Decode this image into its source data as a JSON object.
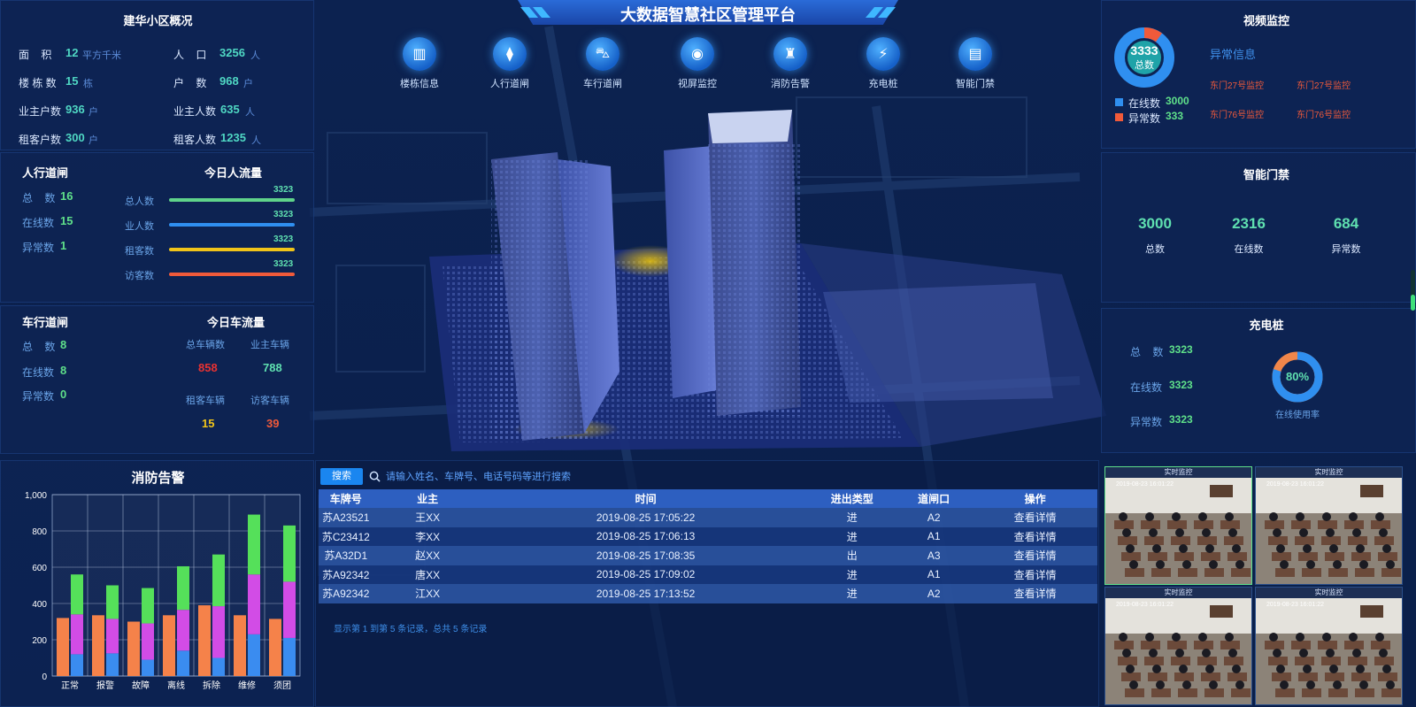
{
  "header": {
    "title": "大数据智慧社区管理平台"
  },
  "nav": [
    {
      "label": "楼栋信息",
      "icon": "building-icon"
    },
    {
      "label": "人行道闸",
      "icon": "pedestrian-gate-icon"
    },
    {
      "label": "车行道闸",
      "icon": "vehicle-gate-icon"
    },
    {
      "label": "视屏监控",
      "icon": "camera-icon"
    },
    {
      "label": "消防告警",
      "icon": "fire-hydrant-icon"
    },
    {
      "label": "充电桩",
      "icon": "charging-pile-icon"
    },
    {
      "label": "智能门禁",
      "icon": "door-access-icon"
    }
  ],
  "overview": {
    "title": "建华小区概况",
    "area_label": "面    积",
    "area_value": "12",
    "area_unit": "平方千米",
    "pop_label": "人    口",
    "pop_value": "3256",
    "pop_unit": "人",
    "bld_label": "楼 栋 数",
    "bld_value": "15",
    "bld_unit": "栋",
    "hh_label": "户    数",
    "hh_value": "968",
    "hh_unit": "户",
    "owner_hh_label": "业主户数",
    "owner_hh_value": "936",
    "owner_hh_unit": "户",
    "owner_pop_label": "业主人数",
    "owner_pop_value": "635",
    "owner_pop_unit": "人",
    "tenant_hh_label": "租客户数",
    "tenant_hh_value": "300",
    "tenant_hh_unit": "户",
    "tenant_pop_label": "租客人数",
    "tenant_pop_value": "1235",
    "tenant_pop_unit": "人"
  },
  "ped_gate": {
    "title": "人行道闸",
    "total_label": "总    数",
    "total_value": "16",
    "online_label": "在线数",
    "online_value": "15",
    "abn_label": "异常数",
    "abn_value": "1"
  },
  "ped_flow": {
    "title": "今日人流量",
    "rows": [
      {
        "label": "总人数",
        "value": "3323",
        "color": "#5fd38a"
      },
      {
        "label": "业人数",
        "value": "3323",
        "color": "#2f8ff0"
      },
      {
        "label": "租客数",
        "value": "3323",
        "color": "#f0c419"
      },
      {
        "label": "访客数",
        "value": "3323",
        "color": "#f05a3a"
      }
    ]
  },
  "car_gate": {
    "title": "车行道闸",
    "total_label": "总    数",
    "total_value": "8",
    "online_label": "在线数",
    "online_value": "8",
    "abn_label": "异常数",
    "abn_value": "0"
  },
  "car_flow": {
    "title": "今日车流量",
    "total_label": "总车辆数",
    "total_value": "858",
    "owner_label": "业主车辆",
    "owner_value": "788",
    "tenant_label": "租客车辆",
    "tenant_value": "15",
    "visitor_label": "访客车辆",
    "visitor_value": "39"
  },
  "fire": {
    "title": "消防告警",
    "chart_data": {
      "type": "bar",
      "categories": [
        "正常",
        "报警",
        "故障",
        "离线",
        "拆除",
        "维修",
        "须团"
      ],
      "ylim": [
        0,
        1000
      ],
      "yticks": [
        "0",
        "200",
        "400",
        "600",
        "800",
        "1,000"
      ],
      "series": [
        {
          "color": "#f5824a",
          "values": [
            320,
            335,
            300,
            335,
            390,
            335,
            315
          ]
        },
        {
          "color": "#3a8cf0",
          "values": [
            120,
            125,
            90,
            140,
            100,
            230,
            210
          ]
        },
        {
          "color": "#d24ce6",
          "values": [
            220,
            190,
            200,
            225,
            285,
            330,
            310
          ]
        },
        {
          "color": "#55e05a",
          "values": [
            220,
            185,
            195,
            240,
            285,
            330,
            310
          ]
        }
      ]
    }
  },
  "search": {
    "button": "搜索",
    "placeholder": "请输入姓名、车牌号、电话号码等进行搜索"
  },
  "table": {
    "headers": [
      "车牌号",
      "业主",
      "时间",
      "进出类型",
      "道闸口",
      "操作"
    ],
    "rows": [
      [
        "苏A23521",
        "王XX",
        "2019-08-25 17:05:22",
        "进",
        "A2",
        "查看详情"
      ],
      [
        "苏C23412",
        "李XX",
        "2019-08-25 17:06:13",
        "进",
        "A1",
        "查看详情"
      ],
      [
        "苏A32D1",
        "赵XX",
        "2019-08-25 17:08:35",
        "出",
        "A3",
        "查看详情"
      ],
      [
        "苏A92342",
        "唐XX",
        "2019-08-25 17:09:02",
        "进",
        "A1",
        "查看详情"
      ],
      [
        "苏A92342",
        "江XX",
        "2019-08-25 17:13:52",
        "进",
        "A2",
        "查看详情"
      ]
    ],
    "pager": "显示第 1 到第 5 条记录，总共 5 条记录"
  },
  "video": {
    "title": "视频监控",
    "ring_value": "3333",
    "ring_label": "总数",
    "online_label": "在线数",
    "online_value": "3000",
    "abn_label": "异常数",
    "abn_value": "333",
    "alert_title": "异常信息",
    "alerts": [
      "东门27号监控",
      "东门27号监控",
      "东门76号监控",
      "东门76号监控"
    ]
  },
  "door": {
    "title": "智能门禁",
    "total_value": "3000",
    "total_label": "总数",
    "online_value": "2316",
    "online_label": "在线数",
    "abn_value": "684",
    "abn_label": "异常数"
  },
  "charge": {
    "title": "充电桩",
    "total_label": "总    数",
    "total_value": "3323",
    "online_label": "在线数",
    "online_value": "3323",
    "abn_label": "异常数",
    "abn_value": "3323",
    "ring_value": "80%",
    "ring_fraction": 0.8,
    "ring_label": "在线使用率"
  },
  "cams": [
    {
      "title": "实时监控",
      "time": "2019-08-23 16:01:22"
    },
    {
      "title": "实时监控",
      "time": "2019-08-23 16:01:22"
    },
    {
      "title": "实时监控",
      "time": "2019-08-23 16:01:22"
    },
    {
      "title": "实时监控",
      "time": "2019-08-23 16:01:22"
    }
  ]
}
